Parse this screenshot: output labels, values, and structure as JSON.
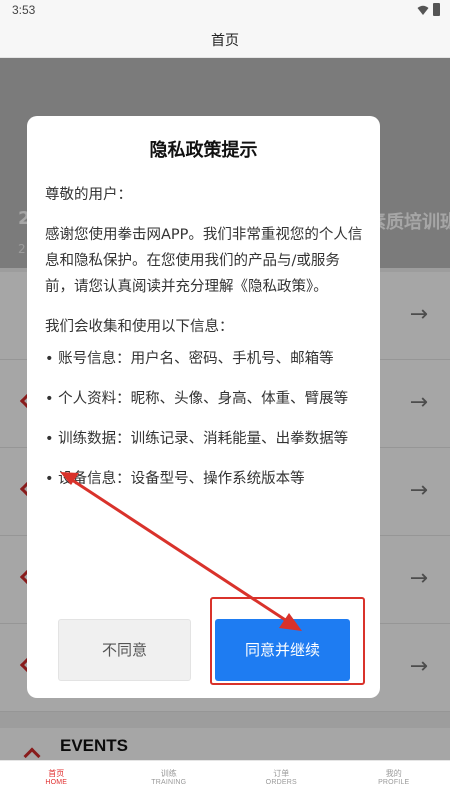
{
  "status_bar": {
    "time": "3:53"
  },
  "header": {
    "title": "首页"
  },
  "banner": {
    "title_left": "2",
    "title_right": "素质培训班",
    "subtitle": "2"
  },
  "list": {
    "arrow": "→",
    "count": 5
  },
  "events": {
    "title": "EVENTS"
  },
  "bottom_nav": [
    {
      "cn": "首页",
      "en": "HOME",
      "active": true
    },
    {
      "cn": "训练",
      "en": "TRAINING",
      "active": false
    },
    {
      "cn": "订单",
      "en": "ORDERS",
      "active": false
    },
    {
      "cn": "我的",
      "en": "PROFILE",
      "active": false
    }
  ],
  "dialog": {
    "title": "隐私政策提示",
    "greeting": "尊敬的用户：",
    "intro": "感谢您使用拳击网APP。我们非常重视您的个人信息和隐私保护。在您使用我们的产品与/或服务前，请您认真阅读并充分理解《隐私政策》。",
    "collect_intro": "我们会收集和使用以下信息：",
    "items": [
      "• 账号信息：用户名、密码、手机号、邮箱等",
      "• 个人资料：昵称、头像、身高、体重、臂展等",
      "• 训练数据：训练记录、消耗能量、出拳数据等",
      "• 设备信息：设备型号、操作系统版本等"
    ],
    "disagree_label": "不同意",
    "agree_label": "同意并继续"
  },
  "colors": {
    "accent_blue": "#1e7cf2",
    "annotation_red": "#d9322b",
    "nav_active": "#e03030"
  }
}
